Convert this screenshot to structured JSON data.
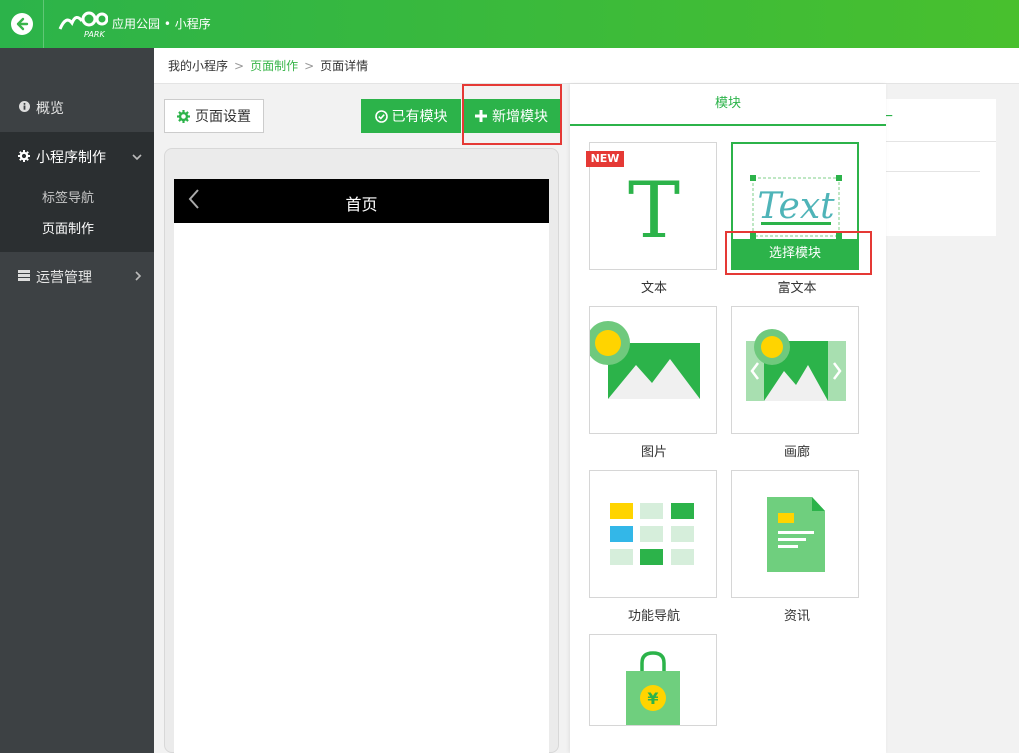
{
  "header": {
    "app_title": "应用公园 • 小程序",
    "logo_text": "PARK"
  },
  "sidebar": {
    "items": [
      {
        "label": "概览",
        "icon": "info-icon"
      },
      {
        "label": "小程序制作",
        "icon": "gear-icon",
        "sub": [
          "标签导航",
          "页面制作"
        ],
        "active_sub": "页面制作"
      },
      {
        "label": "运营管理",
        "icon": "list-icon"
      }
    ]
  },
  "breadcrumb": [
    "我的小程序",
    "页面制作",
    "页面详情"
  ],
  "toolbar": {
    "settings_label": "页面设置",
    "existing_label": "已有模块",
    "new_label": "新增模块"
  },
  "phone": {
    "title": "首页"
  },
  "module_panel": {
    "tab": "模块",
    "new_badge": "NEW",
    "select_label": "选择模块",
    "rich_text_sample": "Text",
    "text_sample": "T",
    "modules": [
      {
        "label": "文本",
        "icon": "text-icon"
      },
      {
        "label": "富文本",
        "icon": "rich-text-icon"
      },
      {
        "label": "图片",
        "icon": "image-icon"
      },
      {
        "label": "画廊",
        "icon": "gallery-icon"
      },
      {
        "label": "功能导航",
        "icon": "grid-nav-icon"
      },
      {
        "label": "资讯",
        "icon": "document-icon"
      },
      {
        "label": "",
        "icon": "shopping-bag-icon"
      }
    ]
  },
  "colors": {
    "brand_green": "#2cb34a",
    "highlight_red": "#e53935",
    "sidebar_bg": "#3d4144"
  }
}
